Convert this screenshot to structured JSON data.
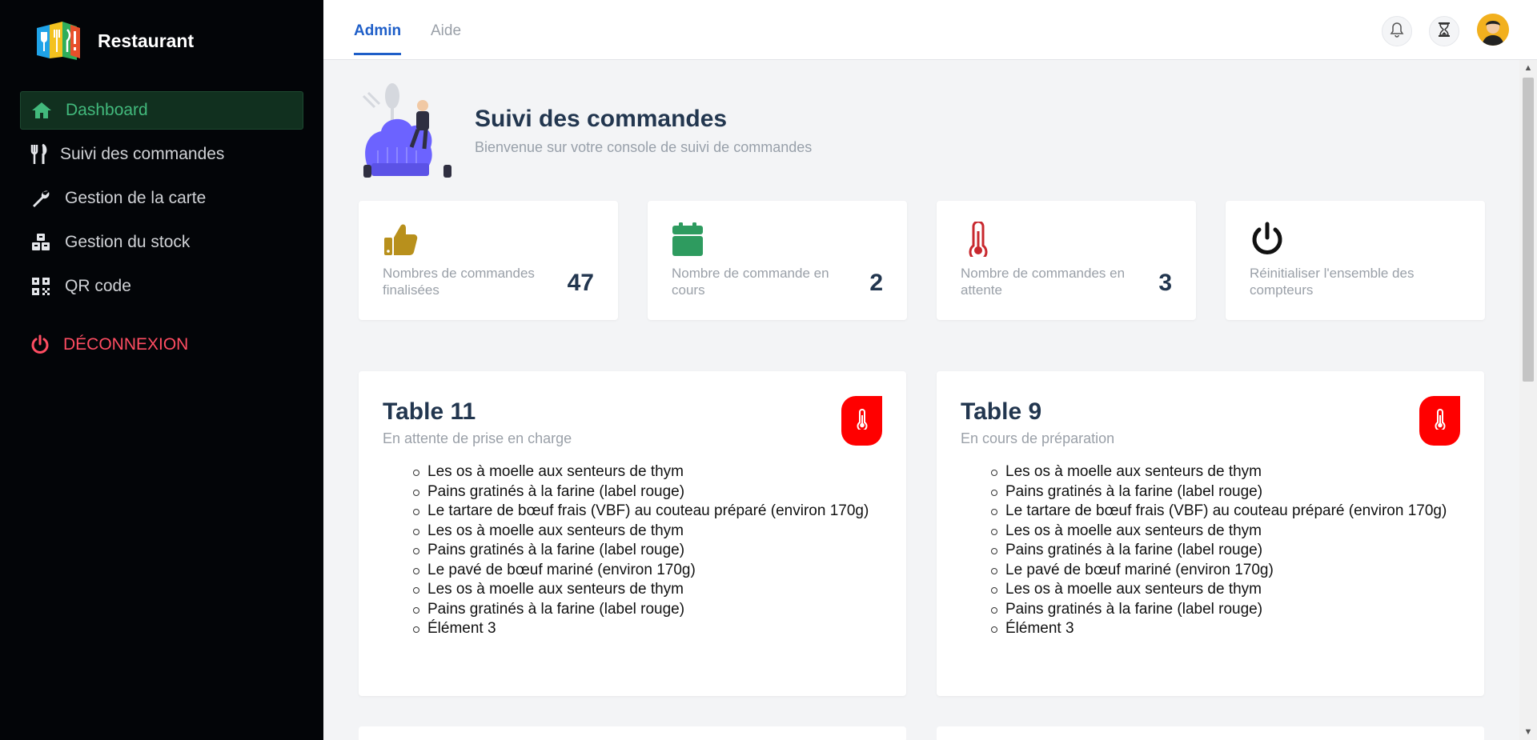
{
  "app": {
    "name": "Restaurant"
  },
  "sidebar": {
    "items": [
      {
        "label": "Dashboard",
        "icon": "home-icon",
        "active": true
      },
      {
        "label": "Suivi des commandes",
        "icon": "utensils-icon"
      },
      {
        "label": "Gestion de la carte",
        "icon": "wrench-icon"
      },
      {
        "label": "Gestion du stock",
        "icon": "boxes-icon"
      },
      {
        "label": "QR code",
        "icon": "qr-code-icon"
      }
    ],
    "logout": "DÉCONNEXION"
  },
  "topbar": {
    "tabs": [
      "Admin",
      "Aide"
    ],
    "active_tab": "Admin"
  },
  "header": {
    "title": "Suivi des commandes",
    "subtitle": "Bienvenue sur votre console de suivi de commandes"
  },
  "stats": [
    {
      "label": "Nombres de commandes finalisées",
      "value": "47",
      "icon": "thumbs-up-icon",
      "color": "#b8901c"
    },
    {
      "label": "Nombre de commande en cours",
      "value": "2",
      "icon": "calendar-icon",
      "color": "#2e9b5f"
    },
    {
      "label": "Nombre de commandes en attente",
      "value": "3",
      "icon": "thermometer-icon",
      "color": "#c8282e"
    },
    {
      "label": "Réinitialiser l'ensemble des compteurs",
      "value": "",
      "icon": "power-icon",
      "color": "#111111"
    }
  ],
  "orders": [
    {
      "title": "Table 11",
      "status": "En attente de prise en charge",
      "items": [
        "Les os à moelle aux senteurs de thym",
        "Pains gratinés à la farine (label rouge)",
        "Le tartare de bœuf frais (VBF) au couteau préparé (environ 170g)",
        "Les os à moelle aux senteurs de thym",
        "Pains gratinés à la farine (label rouge)",
        "Le pavé de bœuf mariné (environ 170g)",
        "Les os à moelle aux senteurs de thym",
        "Pains gratinés à la farine (label rouge)",
        "Élément 3"
      ]
    },
    {
      "title": "Table 9",
      "status": "En cours de préparation",
      "items": [
        "Les os à moelle aux senteurs de thym",
        "Pains gratinés à la farine (label rouge)",
        "Le tartare de bœuf frais (VBF) au couteau préparé (environ 170g)",
        "Les os à moelle aux senteurs de thym",
        "Pains gratinés à la farine (label rouge)",
        "Le pavé de bœuf mariné (environ 170g)",
        "Les os à moelle aux senteurs de thym",
        "Pains gratinés à la farine (label rouge)",
        "Élément 3"
      ]
    }
  ],
  "colors": {
    "sidebar_bg": "#030508",
    "active_green": "#42b97c",
    "logout_red": "#ff4d62",
    "primary_blue": "#1e5ec8",
    "badge_red": "#ff0000",
    "heading": "#22364f"
  }
}
